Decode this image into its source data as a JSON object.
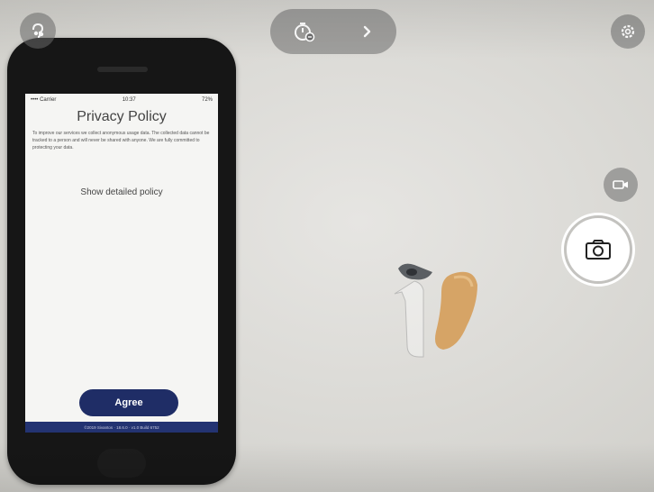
{
  "icons": {
    "top_left": "hearing-aid-icon",
    "timer": "timer-icon",
    "chevron": "chevron-right-icon",
    "settings": "gear-icon",
    "video": "video-camera-icon",
    "shutter": "camera-icon"
  },
  "phone": {
    "status_bar": {
      "carrier": "•••• Carrier",
      "time": "10:37",
      "battery": "72%"
    },
    "title": "Privacy Policy",
    "body": "To improve our services we collect anonymous usage data. The collected data cannot be tracked to a person and will never be shared with anyone. We are fully committed to protecting your data.",
    "detail_link": "Show detailed policy",
    "agree_button": "Agree",
    "footer": "©2019 Sivantos · 18.6.0 · v1.0 Build 6752"
  },
  "colors": {
    "agree_button": "#1f2d66",
    "footer_bar": "#233372"
  }
}
